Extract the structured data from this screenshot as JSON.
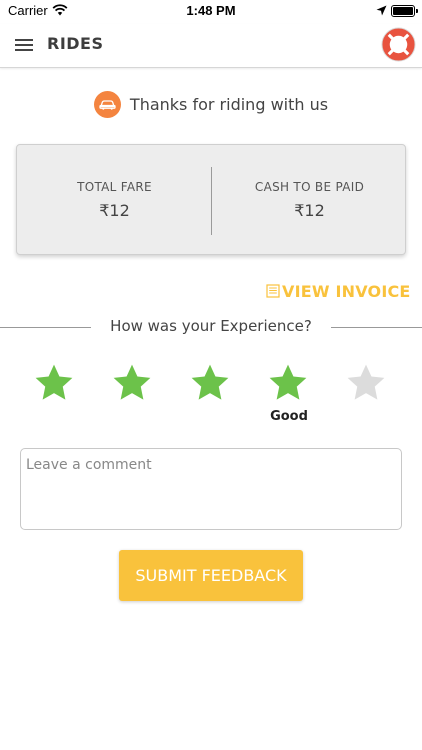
{
  "status_bar": {
    "carrier": "Carrier",
    "time": "1:48 PM",
    "icons": [
      "wifi-icon",
      "location-arrow-icon",
      "battery-icon"
    ]
  },
  "nav": {
    "title": "RIDES",
    "menu_icon": "hamburger-menu-icon",
    "help_icon": "lifebuoy-icon"
  },
  "thanks": {
    "icon": "car-icon",
    "text": "Thanks for riding with us"
  },
  "fare": {
    "total_label": "TOTAL FARE",
    "total_value": "₹12",
    "cash_label": "CASH TO BE PAID",
    "cash_value": "₹12"
  },
  "invoice": {
    "icon": "invoice-document-icon",
    "label": "VIEW INVOICE"
  },
  "experience": {
    "question": "How was your Experience?",
    "rating": 4,
    "max_rating": 5,
    "rating_label": "Good"
  },
  "comment": {
    "placeholder": "Leave a comment",
    "value": ""
  },
  "submit": {
    "label": "SUBMIT FEEDBACK"
  },
  "colors": {
    "accent": "#f9c23c",
    "car_badge": "#f4843f",
    "star_on": "#6cc24a",
    "star_off": "#dcdcdc",
    "lifebuoy_red": "#e8533f"
  }
}
